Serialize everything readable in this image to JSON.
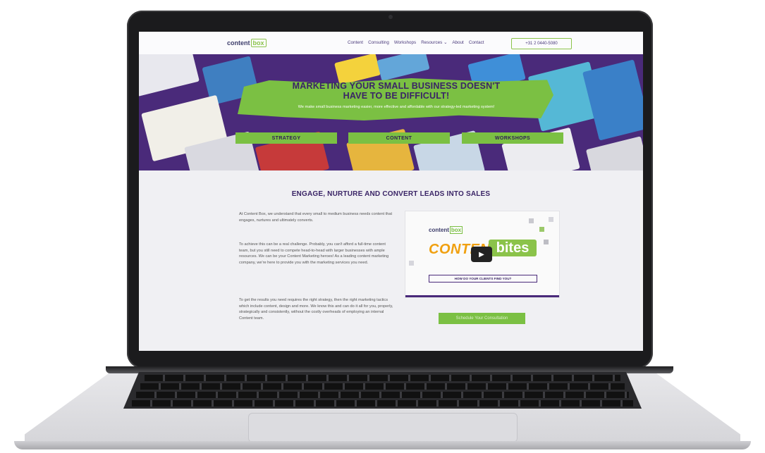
{
  "site": {
    "logo": {
      "part1": "content",
      "part2": "box"
    },
    "nav": {
      "items": [
        "Content",
        "Consulting",
        "Workshops",
        "Resources ⌄",
        "About",
        "Contact"
      ],
      "phone": "+31 2 0440-5080"
    },
    "hero": {
      "title_line1": "MARKETING YOUR SMALL BUSINESS DOESN'T",
      "title_line2": "HAVE TO BE DIFFICULT!",
      "subtitle": "We make small business marketing easier, more effective and affordable with our strategy-led marketing system!",
      "buttons": [
        "STRATEGY",
        "CONTENT",
        "WORKSHOPS"
      ]
    },
    "main": {
      "heading": "ENGAGE, NURTURE AND CONVERT LEADS INTO SALES",
      "paragraphs": [
        "At Content Box, we understand that every small to medium business needs content that engages, nurtures and ultimately converts.",
        "To achieve this can be a real challenge. Probably, you can't afford a full-time content team, but you still need to compete head-to-head with larger businesses with ample resources. We can be your Content Marketing heroes! As a leading content marketing company, we're here to provide you with the marketing services you need.",
        "To get the results you need requires the right strategy, then the right marketing tactics which include content, design and more. We know this and can do it all for you, properly, strategically and consistently, without the costly overheads of employing an internal Content team."
      ],
      "video": {
        "logo_part1": "content",
        "logo_part2": "box",
        "word1": "CONTENT",
        "word2": "bites",
        "caption": "HOW DO YOUR CLIENTS FIND YOU?",
        "play_icon": "play-icon"
      },
      "cta_label": "Schedule Your Consultation"
    }
  },
  "colors": {
    "brand_purple": "#4a2a7a",
    "brand_green": "#7bc043",
    "laptop_frame": "#1b1b1d"
  }
}
